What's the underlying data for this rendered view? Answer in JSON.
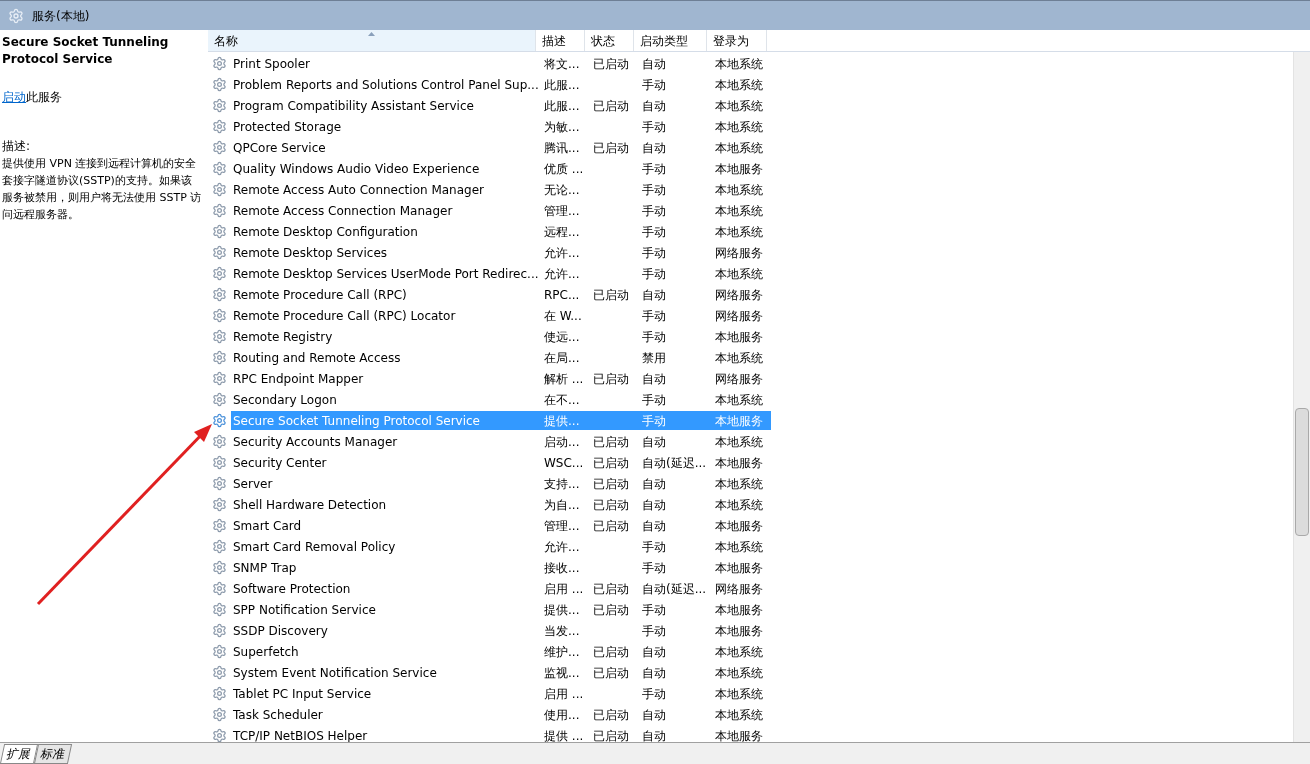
{
  "window": {
    "title": "服务(本地)"
  },
  "detail": {
    "title": "Secure Socket Tunneling Protocol Service",
    "action_link": "启动",
    "action_rest": "此服务",
    "description_label": "描述:",
    "description": "提供使用 VPN 连接到远程计算机的安全套接字隧道协议(SSTP)的支持。如果该服务被禁用，则用户将无法使用 SSTP 访问远程服务器。"
  },
  "table": {
    "columns": [
      {
        "label": "名称",
        "sorted": true
      },
      {
        "label": "描述",
        "sorted": false
      },
      {
        "label": "状态",
        "sorted": false
      },
      {
        "label": "启动类型",
        "sorted": false
      },
      {
        "label": "登录为",
        "sorted": false
      }
    ],
    "rows": [
      {
        "name": "Print Spooler",
        "desc": "将文...",
        "status": "已启动",
        "startup": "自动",
        "logon": "本地系统",
        "selected": false
      },
      {
        "name": "Problem Reports and Solutions Control Panel Sup...",
        "desc": "此服...",
        "status": "",
        "startup": "手动",
        "logon": "本地系统",
        "selected": false
      },
      {
        "name": "Program Compatibility Assistant Service",
        "desc": "此服...",
        "status": "已启动",
        "startup": "自动",
        "logon": "本地系统",
        "selected": false
      },
      {
        "name": "Protected Storage",
        "desc": "为敏...",
        "status": "",
        "startup": "手动",
        "logon": "本地系统",
        "selected": false
      },
      {
        "name": "QPCore Service",
        "desc": "腾讯...",
        "status": "已启动",
        "startup": "自动",
        "logon": "本地系统",
        "selected": false
      },
      {
        "name": "Quality Windows Audio Video Experience",
        "desc": "优质 ...",
        "status": "",
        "startup": "手动",
        "logon": "本地服务",
        "selected": false
      },
      {
        "name": "Remote Access Auto Connection Manager",
        "desc": "无论...",
        "status": "",
        "startup": "手动",
        "logon": "本地系统",
        "selected": false
      },
      {
        "name": "Remote Access Connection Manager",
        "desc": "管理...",
        "status": "",
        "startup": "手动",
        "logon": "本地系统",
        "selected": false
      },
      {
        "name": "Remote Desktop Configuration",
        "desc": "远程...",
        "status": "",
        "startup": "手动",
        "logon": "本地系统",
        "selected": false
      },
      {
        "name": "Remote Desktop Services",
        "desc": "允许...",
        "status": "",
        "startup": "手动",
        "logon": "网络服务",
        "selected": false
      },
      {
        "name": "Remote Desktop Services UserMode Port Redirec...",
        "desc": "允许...",
        "status": "",
        "startup": "手动",
        "logon": "本地系统",
        "selected": false
      },
      {
        "name": "Remote Procedure Call (RPC)",
        "desc": "RPC...",
        "status": "已启动",
        "startup": "自动",
        "logon": "网络服务",
        "selected": false
      },
      {
        "name": "Remote Procedure Call (RPC) Locator",
        "desc": "在 W...",
        "status": "",
        "startup": "手动",
        "logon": "网络服务",
        "selected": false
      },
      {
        "name": "Remote Registry",
        "desc": "使远...",
        "status": "",
        "startup": "手动",
        "logon": "本地服务",
        "selected": false
      },
      {
        "name": "Routing and Remote Access",
        "desc": "在局...",
        "status": "",
        "startup": "禁用",
        "logon": "本地系统",
        "selected": false
      },
      {
        "name": "RPC Endpoint Mapper",
        "desc": "解析 ...",
        "status": "已启动",
        "startup": "自动",
        "logon": "网络服务",
        "selected": false
      },
      {
        "name": "Secondary Logon",
        "desc": "在不...",
        "status": "",
        "startup": "手动",
        "logon": "本地系统",
        "selected": false
      },
      {
        "name": "Secure Socket Tunneling Protocol Service",
        "desc": "提供...",
        "status": "",
        "startup": "手动",
        "logon": "本地服务",
        "selected": true
      },
      {
        "name": "Security Accounts Manager",
        "desc": "启动...",
        "status": "已启动",
        "startup": "自动",
        "logon": "本地系统",
        "selected": false
      },
      {
        "name": "Security Center",
        "desc": "WSC...",
        "status": "已启动",
        "startup": "自动(延迟...",
        "logon": "本地服务",
        "selected": false
      },
      {
        "name": "Server",
        "desc": "支持...",
        "status": "已启动",
        "startup": "自动",
        "logon": "本地系统",
        "selected": false
      },
      {
        "name": "Shell Hardware Detection",
        "desc": "为自...",
        "status": "已启动",
        "startup": "自动",
        "logon": "本地系统",
        "selected": false
      },
      {
        "name": "Smart Card",
        "desc": "管理...",
        "status": "已启动",
        "startup": "自动",
        "logon": "本地服务",
        "selected": false
      },
      {
        "name": "Smart Card Removal Policy",
        "desc": "允许...",
        "status": "",
        "startup": "手动",
        "logon": "本地系统",
        "selected": false
      },
      {
        "name": "SNMP Trap",
        "desc": "接收...",
        "status": "",
        "startup": "手动",
        "logon": "本地服务",
        "selected": false
      },
      {
        "name": "Software Protection",
        "desc": "启用 ...",
        "status": "已启动",
        "startup": "自动(延迟...",
        "logon": "网络服务",
        "selected": false
      },
      {
        "name": "SPP Notification Service",
        "desc": "提供...",
        "status": "已启动",
        "startup": "手动",
        "logon": "本地服务",
        "selected": false
      },
      {
        "name": "SSDP Discovery",
        "desc": "当发...",
        "status": "",
        "startup": "手动",
        "logon": "本地服务",
        "selected": false
      },
      {
        "name": "Superfetch",
        "desc": "维护...",
        "status": "已启动",
        "startup": "自动",
        "logon": "本地系统",
        "selected": false
      },
      {
        "name": "System Event Notification Service",
        "desc": "监视...",
        "status": "已启动",
        "startup": "自动",
        "logon": "本地系统",
        "selected": false
      },
      {
        "name": "Tablet PC Input Service",
        "desc": "启用 ...",
        "status": "",
        "startup": "手动",
        "logon": "本地系统",
        "selected": false
      },
      {
        "name": "Task Scheduler",
        "desc": "使用...",
        "status": "已启动",
        "startup": "自动",
        "logon": "本地系统",
        "selected": false
      },
      {
        "name": "TCP/IP NetBIOS Helper",
        "desc": "提供 ...",
        "status": "已启动",
        "startup": "自动",
        "logon": "本地服务",
        "selected": false
      }
    ]
  },
  "bottom_tabs": [
    {
      "label": "扩展",
      "selected": true
    },
    {
      "label": "标准",
      "selected": false
    }
  ]
}
